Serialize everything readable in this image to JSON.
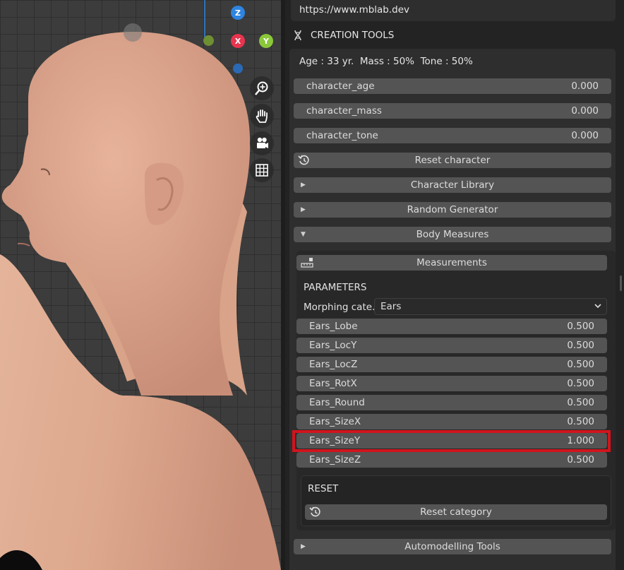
{
  "panel": {
    "url": "https://www.mblab.dev",
    "section_title": "CREATION TOOLS",
    "section_icon": "dna-icon",
    "stats": "Age : 33 yr.  Mass : 50%  Tone : 50%",
    "sliders": [
      {
        "label": "character_age",
        "value": "0.000"
      },
      {
        "label": "character_mass",
        "value": "0.000"
      },
      {
        "label": "character_tone",
        "value": "0.000"
      }
    ],
    "reset_character": "Reset character",
    "collapsibles": {
      "character_library": "Character Library",
      "random_generator": "Random Generator",
      "body_measures": "Body Measures",
      "automodelling": "Automodelling Tools"
    },
    "body_measures": {
      "measurements_button": "Measurements",
      "parameters_label": "PARAMETERS",
      "morphing_label": "Morphing cate..",
      "morphing_value": "Ears",
      "params": [
        {
          "label": "Ears_Lobe",
          "value": "0.500"
        },
        {
          "label": "Ears_LocY",
          "value": "0.500"
        },
        {
          "label": "Ears_LocZ",
          "value": "0.500"
        },
        {
          "label": "Ears_RotX",
          "value": "0.500"
        },
        {
          "label": "Ears_Round",
          "value": "0.500"
        },
        {
          "label": "Ears_SizeX",
          "value": "0.500"
        },
        {
          "label": "Ears_SizeY",
          "value": "1.000"
        },
        {
          "label": "Ears_SizeZ",
          "value": "0.500"
        }
      ],
      "reset_label": "RESET",
      "reset_category": "Reset category"
    }
  },
  "viewport": {
    "gizmo": {
      "z": "Z",
      "x": "X",
      "y": "Y"
    },
    "nav_icons": [
      "zoom-icon",
      "hand-pan-icon",
      "camera-icon",
      "grid-ortho-icon"
    ]
  },
  "colors": {
    "highlight": "#d1141d",
    "axis_x": "#e8344e",
    "axis_y": "#8ac73a",
    "axis_z": "#2e84e0"
  }
}
